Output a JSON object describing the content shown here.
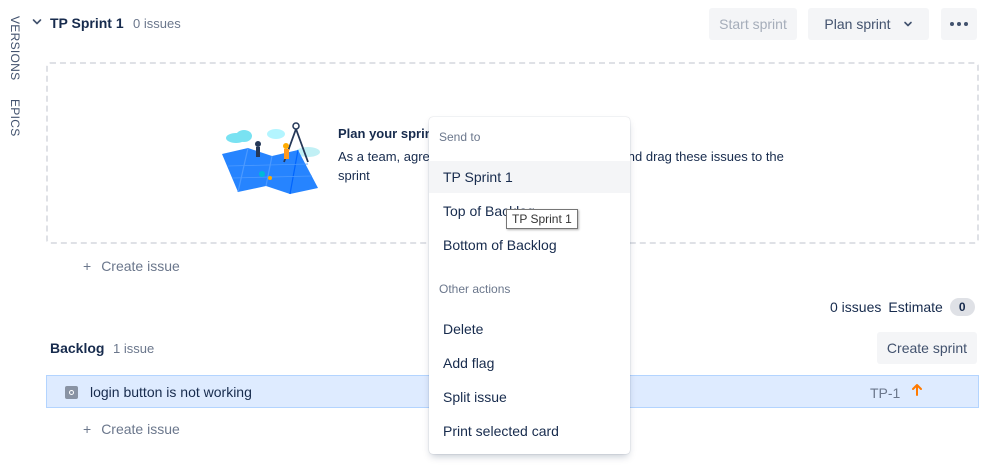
{
  "rail": {
    "versions_label": "VERSIONS",
    "epics_label": "EPICS"
  },
  "sprint": {
    "name": "TP Sprint 1",
    "issue_count": "0 issues",
    "start_button": "Start sprint",
    "plan_button": "Plan sprint",
    "empty_title": "Plan your sprint",
    "empty_description": "As a team, agree on the issues to be completed, and drag these issues to the sprint",
    "create_issue": "Create issue",
    "summary_count": "0 issues",
    "estimate_label": "Estimate",
    "estimate_value": "0"
  },
  "backlog": {
    "title": "Backlog",
    "issue_count": "1 issue",
    "create_sprint_button": "Create sprint",
    "create_issue": "Create issue",
    "issues": [
      {
        "summary": "login button is not working",
        "key": "TP-1",
        "priority": "high"
      }
    ]
  },
  "context_menu": {
    "send_to_heading": "Send to",
    "send_to_items": [
      "TP Sprint 1",
      "Top of Backlog",
      "Bottom of Backlog"
    ],
    "other_heading": "Other actions",
    "other_items": [
      "Delete",
      "Add flag",
      "Split issue",
      "Print selected card"
    ]
  },
  "tooltip": "TP Sprint 1",
  "colors": {
    "accent": "#0052cc",
    "selected_row": "#deebff",
    "priority_high": "#ff7a00",
    "button_bg": "#f4f5f7"
  },
  "icons": [
    "chevron-down-icon",
    "more-icon",
    "plan-illustration",
    "issue-type-icon",
    "priority-high-icon",
    "plus-icon"
  ]
}
